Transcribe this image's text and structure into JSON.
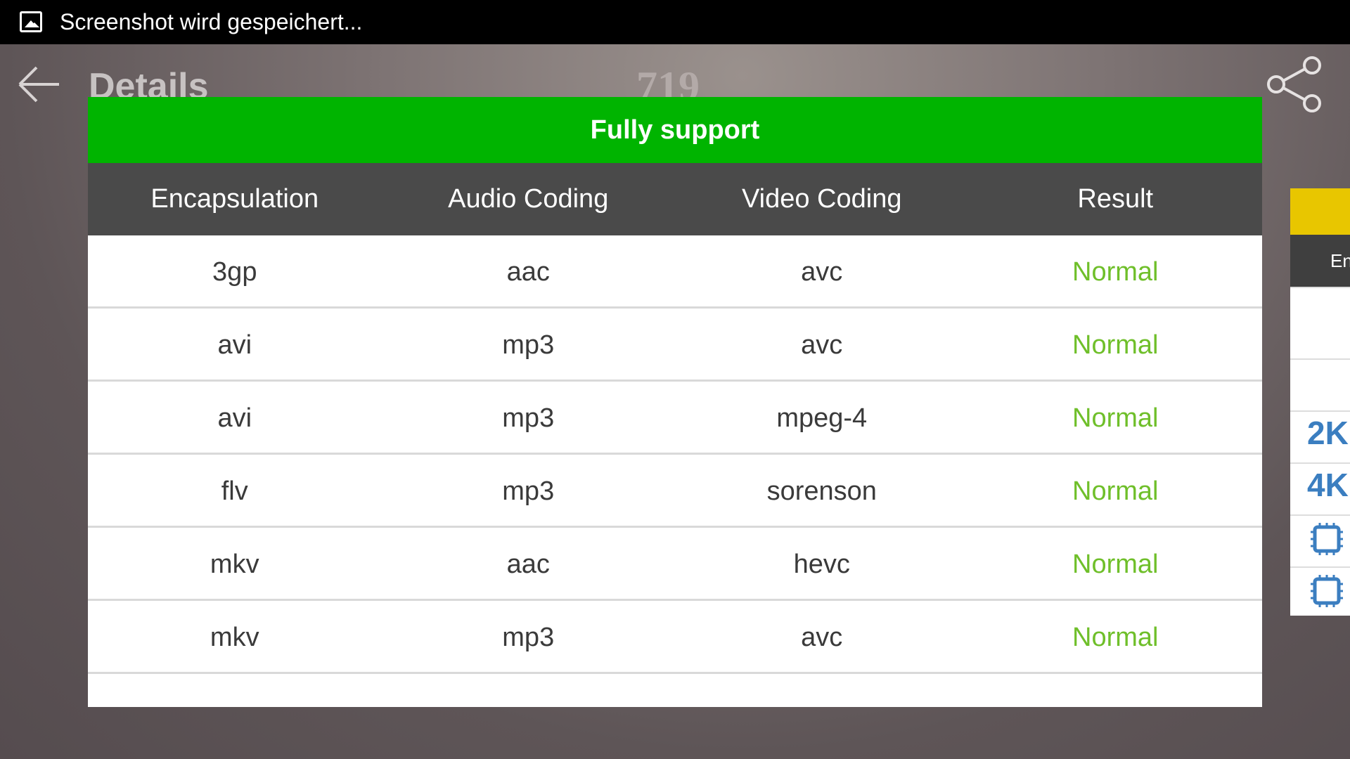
{
  "status_bar": {
    "icon": "image-icon",
    "text": "Screenshot wird gespeichert..."
  },
  "app_bar": {
    "back_icon": "arrow-left-icon",
    "title": "Details",
    "score": "719",
    "share_icon": "share-icon"
  },
  "dialog": {
    "title": "Fully support",
    "colors": {
      "title_bg": "#00b400",
      "header_bg": "#4a4a4a",
      "result": "#6fbf2a"
    },
    "columns": [
      "Encapsulation",
      "Audio Coding",
      "Video Coding",
      "Result"
    ],
    "rows": [
      [
        "3gp",
        "aac",
        "avc",
        "Normal"
      ],
      [
        "avi",
        "mp3",
        "avc",
        "Normal"
      ],
      [
        "avi",
        "mp3",
        "mpeg-4",
        "Normal"
      ],
      [
        "flv",
        "mp3",
        "sorenson",
        "Normal"
      ],
      [
        "mkv",
        "aac",
        "hevc",
        "Normal"
      ],
      [
        "mkv",
        "mp3",
        "avc",
        "Normal"
      ]
    ]
  },
  "side_panel": {
    "header_text": "En",
    "badges": [
      "2K",
      "4K"
    ],
    "chip_icons": [
      "cpu-icon",
      "cpu-icon"
    ]
  }
}
